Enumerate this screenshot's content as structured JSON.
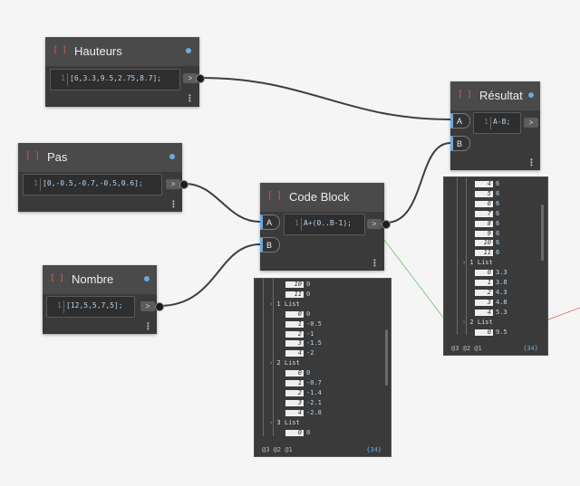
{
  "nodes": {
    "hauteurs": {
      "icon": "[ ]",
      "title": "Hauteurs",
      "line": "1",
      "code": "[6,3.3,9.5,2.75,8.7];",
      "out": ">"
    },
    "pas": {
      "icon": "[ ]",
      "title": "Pas",
      "line": "1",
      "code": "[0,-0.5,-0.7,-0.5,0.6];",
      "out": ">"
    },
    "nombre": {
      "icon": "[ ]",
      "title": "Nombre",
      "line": "1",
      "code": "[12,5,5,7,5];",
      "out": ">"
    },
    "codeblock": {
      "icon": "[ ]",
      "title": "Code Block",
      "line": "1",
      "code": "A+(0..B-1);",
      "out": ">",
      "port_a": "A",
      "port_b": "B"
    },
    "resultat": {
      "icon": "[ ]",
      "title": "Résultat",
      "line": "1",
      "code": "A-B;",
      "out": ">",
      "port_a": "A",
      "port_b": "B"
    }
  },
  "watch_codeblock": {
    "rows": [
      {
        "idx": "10",
        "val": "0"
      },
      {
        "idx": "11",
        "val": "0"
      },
      {
        "list": "1 List"
      },
      {
        "idx": "0",
        "val": "0"
      },
      {
        "idx": "1",
        "val": "-0.5"
      },
      {
        "idx": "2",
        "val": "-1"
      },
      {
        "idx": "3",
        "val": "-1.5"
      },
      {
        "idx": "4",
        "val": "-2"
      },
      {
        "list": "2 List"
      },
      {
        "idx": "0",
        "val": "0"
      },
      {
        "idx": "1",
        "val": "-0.7"
      },
      {
        "idx": "2",
        "val": "-1.4"
      },
      {
        "idx": "3",
        "val": "-2.1"
      },
      {
        "idx": "4",
        "val": "-2.8"
      },
      {
        "list": "3 List"
      },
      {
        "idx": "0",
        "val": "0"
      }
    ],
    "levels": "@3 @2 @1",
    "count": "{34}"
  },
  "watch_resultat": {
    "rows": [
      {
        "idx": "4",
        "val": "6"
      },
      {
        "idx": "5",
        "val": "6"
      },
      {
        "idx": "6",
        "val": "6"
      },
      {
        "idx": "7",
        "val": "6"
      },
      {
        "idx": "8",
        "val": "6"
      },
      {
        "idx": "9",
        "val": "6"
      },
      {
        "idx": "10",
        "val": "6"
      },
      {
        "idx": "11",
        "val": "6"
      },
      {
        "list": "1 List"
      },
      {
        "idx": "0",
        "val": "3.3"
      },
      {
        "idx": "1",
        "val": "3.8"
      },
      {
        "idx": "2",
        "val": "4.3"
      },
      {
        "idx": "3",
        "val": "4.8"
      },
      {
        "idx": "4",
        "val": "5.3"
      },
      {
        "list": "2 List"
      },
      {
        "idx": "0",
        "val": "9.5"
      }
    ],
    "levels": "@3 @2 @1",
    "count": "{34}"
  },
  "colors": {
    "wire": "#3d3d3d",
    "accent": "#6aa9df",
    "green_wire": "#6fbf6f",
    "red_wire": "#e05a5a"
  }
}
